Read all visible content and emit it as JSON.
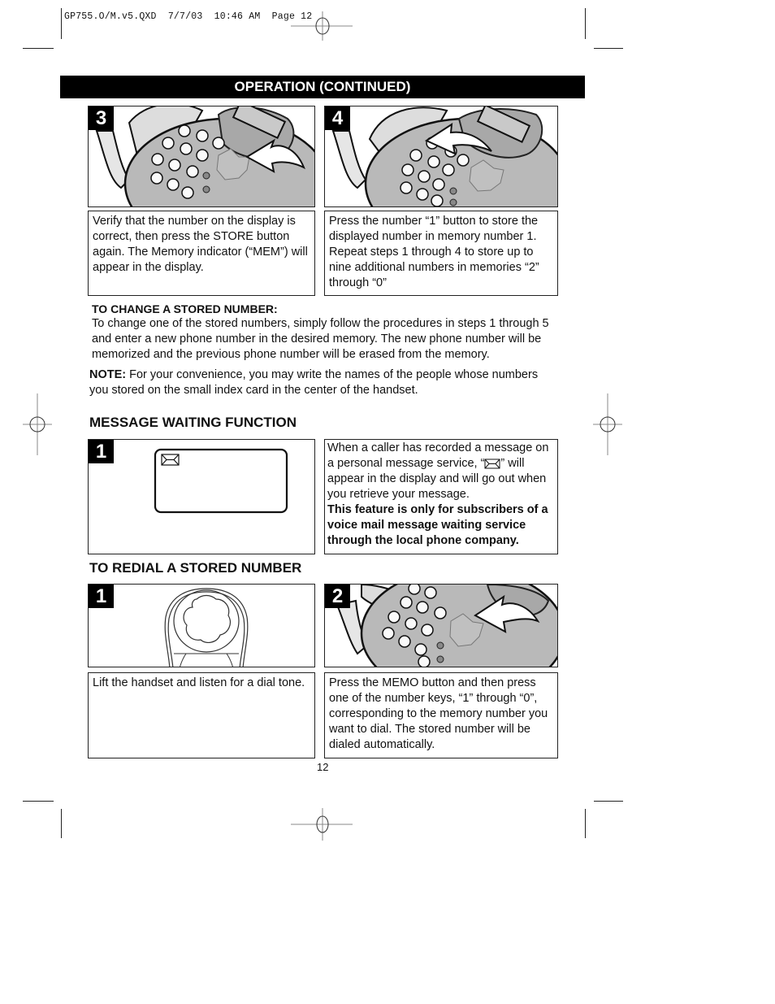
{
  "slug": "GP755.O/M.v5.QXD  7/7/03  10:46 AM  Page 12",
  "banner": "OPERATION (CONTINUED)",
  "store_steps": [
    {
      "number": "3",
      "illustration": "phone-store-button-arrow",
      "text": "Verify that the number on the display is correct, then press the STORE button again. The Memory indicator (“MEM”) will appear in the display."
    },
    {
      "number": "4",
      "illustration": "phone-number-key-arrow",
      "text": "Press the number “1” button to store the displayed number in memory number 1. Repeat steps 1 through 4 to store up to nine additional numbers in memories “2” through “0”"
    }
  ],
  "change_section": {
    "heading": "TO CHANGE A STORED NUMBER:",
    "body": "To change one of the stored numbers, simply follow the procedures in steps 1 through 5 and enter a new phone number in the desired memory. The new phone number will be memorized and the previous phone number will be erased from the memory."
  },
  "note": {
    "label": "NOTE:",
    "body": " For your convenience, you may write the names of the people whose numbers you stored on the small index card in the center of the handset."
  },
  "message_waiting": {
    "heading": "MESSAGE WAITING FUNCTION",
    "step_number": "1",
    "display_icon": "envelope-icon",
    "text_before_icon": "When a caller has recorded a message on a personal message service, “",
    "text_after_icon": "” will appear in the display and will go out when you retrieve your message.",
    "bold_text": "This feature is only for subscribers of a voice mail message waiting service through the local phone company."
  },
  "redial": {
    "heading": "TO REDIAL A STORED NUMBER",
    "steps": [
      {
        "number": "1",
        "illustration": "handset-lift",
        "text": "Lift the handset and listen for a dial tone."
      },
      {
        "number": "2",
        "illustration": "phone-memo-button-arrow",
        "text": "Press the MEMO button and then press one of the number keys, “1” through “0”, corresponding to the memory number you want to dial. The stored number will be dialed automatically."
      }
    ]
  },
  "page_number": "12"
}
